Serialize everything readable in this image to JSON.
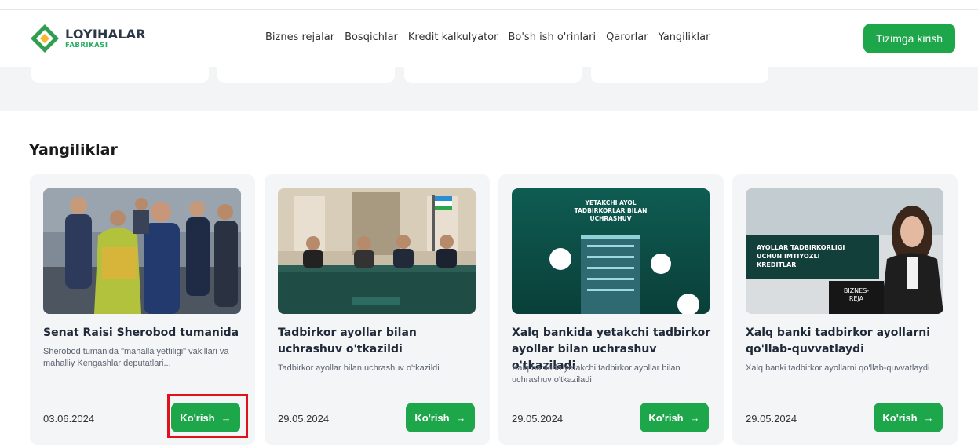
{
  "brand": {
    "name": "LOYIHALAR",
    "sub": "FABRIKASI"
  },
  "nav": [
    "Biznes rejalar",
    "Bosqichlar",
    "Kredit kalkulyator",
    "Bo'sh ish o'rinlari",
    "Qarorlar",
    "Yangiliklar"
  ],
  "login_label": "Tizimga kirish",
  "section_title": "Yangiliklar",
  "more_label": "Ko'rish",
  "colors": {
    "accent": "#1ea64a",
    "highlight": "#e0121b"
  },
  "cards": [
    {
      "title": "Senat Raisi Sherobod tumanida",
      "desc": "Sherobod tumanida \"mahalla yettiligi\" vakillari va mahalliy Kengashlar deputatlari...",
      "date": "03.06.2024"
    },
    {
      "title": "Tadbirkor ayollar bilan uchrashuv o'tkazildi",
      "desc": "Tadbirkor ayollar bilan uchrashuv o'tkazildi",
      "date": "29.05.2024"
    },
    {
      "title": "Xalq bankida yetakchi tadbirkor ayollar bilan uchrashuv o'tkaziladi",
      "desc": "Xalq bankida yetakchi tadbirkor ayollar bilan uchrashuv o'tkaziladi",
      "date": "29.05.2024",
      "image_text": [
        "YETAKCHI AYOL",
        "TADBIRKORLAR BILAN",
        "UCHRASHUV"
      ]
    },
    {
      "title": "Xalq banki tadbirkor ayollarni qo'llab-quvvatlaydi",
      "desc": "Xalq banki tadbirkor ayollarni qo'llab-quvvatlaydi",
      "date": "29.05.2024",
      "image_text": [
        "AYOLLAR TADBIRKORLIGI",
        "UCHUN IMTIYOZLI",
        "KREDITLAR"
      ],
      "image_tag": [
        "BIZNES-",
        "REJA"
      ]
    }
  ]
}
